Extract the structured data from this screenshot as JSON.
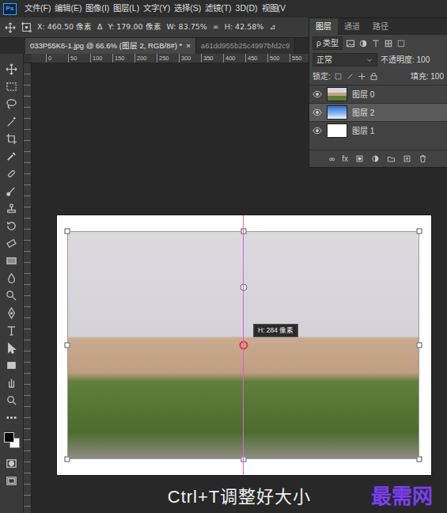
{
  "app": {
    "logo": "Ps"
  },
  "menu": [
    "文件(F)",
    "编辑(E)",
    "图像(I)",
    "图层(L)",
    "文字(Y)",
    "选择(S)",
    "滤镜(T)",
    "3D(D)",
    "视图(V"
  ],
  "options": [
    "X: 460.50 像素",
    "Δ",
    "Y: 179.00 像素",
    "W: 83.75%",
    "∞",
    "H: 42.58%",
    "⊿"
  ],
  "document_tabs": [
    {
      "label": "033P55K6-1.jpg @ 66.6% (图层 2, RGB/8#) *",
      "close": "×",
      "selected": true
    },
    {
      "label": "a61dd955b25c4997bfd2c9",
      "selected": false
    }
  ],
  "ruler": {
    "ticks": [
      "0",
      "50",
      "100",
      "150",
      "200",
      "250",
      "300",
      "350",
      "400",
      "450",
      "500",
      "550"
    ]
  },
  "canvas": {
    "tooltip": "H: 284 像素"
  },
  "caption": "Ctrl+T调整好大小",
  "watermark": "最需网",
  "layers_panel": {
    "tabs": [
      {
        "label": "图层",
        "selected": true
      },
      {
        "label": "通道",
        "selected": false
      },
      {
        "label": "路径",
        "selected": false
      }
    ],
    "search_label": "ρ 类型",
    "blend_mode": "正常",
    "opacity": "不透明度: 100",
    "lock": "锁定:",
    "fill": "填充: 100",
    "layers": [
      {
        "name": "图层 0",
        "visible": true,
        "selected": false,
        "kind": "photo"
      },
      {
        "name": "图层 2",
        "visible": true,
        "selected": true,
        "kind": "sky"
      },
      {
        "name": "图层 1",
        "visible": true,
        "selected": false,
        "kind": "blank"
      }
    ],
    "footer": [
      "∞",
      "fx"
    ]
  }
}
